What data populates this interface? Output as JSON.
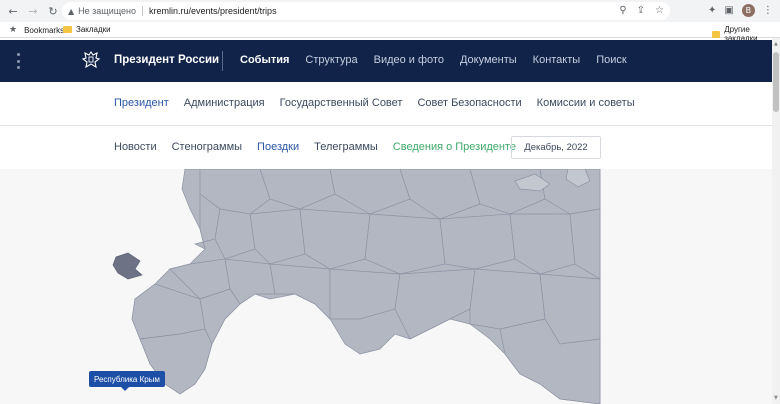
{
  "browser": {
    "back_icon": "←",
    "forward_icon": "→",
    "reload_icon": "↻",
    "security_icon": "▲",
    "security_text": "Не защищено",
    "url": "kremlin.ru/events/president/trips",
    "zoom_icon": "⚲",
    "share_icon": "⇪",
    "bookmark_star_icon": "☆",
    "extensions_icon": "✦",
    "sidebar_icon": "▣",
    "profile_initial": "В",
    "menu_icon": "⋮"
  },
  "bookmarks": {
    "bookmarks_label": "Bookmarks",
    "zakladki_label": "Закладки",
    "other_label": "Другие закладки"
  },
  "site": {
    "name": "Президент России",
    "top_nav": [
      "События",
      "Структура",
      "Видео и фото",
      "Документы",
      "Контакты",
      "Поиск"
    ],
    "sub_nav": [
      "Президент",
      "Администрация",
      "Государственный Совет",
      "Совет Безопасности",
      "Комиссии и советы"
    ],
    "section_nav": [
      "Новости",
      "Стенограммы",
      "Поездки",
      "Телеграммы",
      "Сведения о Президенте"
    ],
    "date_filter": "Декабрь, 2022"
  },
  "map": {
    "tooltip": "Республика Крым",
    "region_color": "#b3b7c2",
    "highlight_color": "#6d7385",
    "border_color": "#8d93a3"
  },
  "colors": {
    "header_bg": "#12234a",
    "accent_blue": "#2a56a6",
    "accent_green": "#3daa6a"
  }
}
